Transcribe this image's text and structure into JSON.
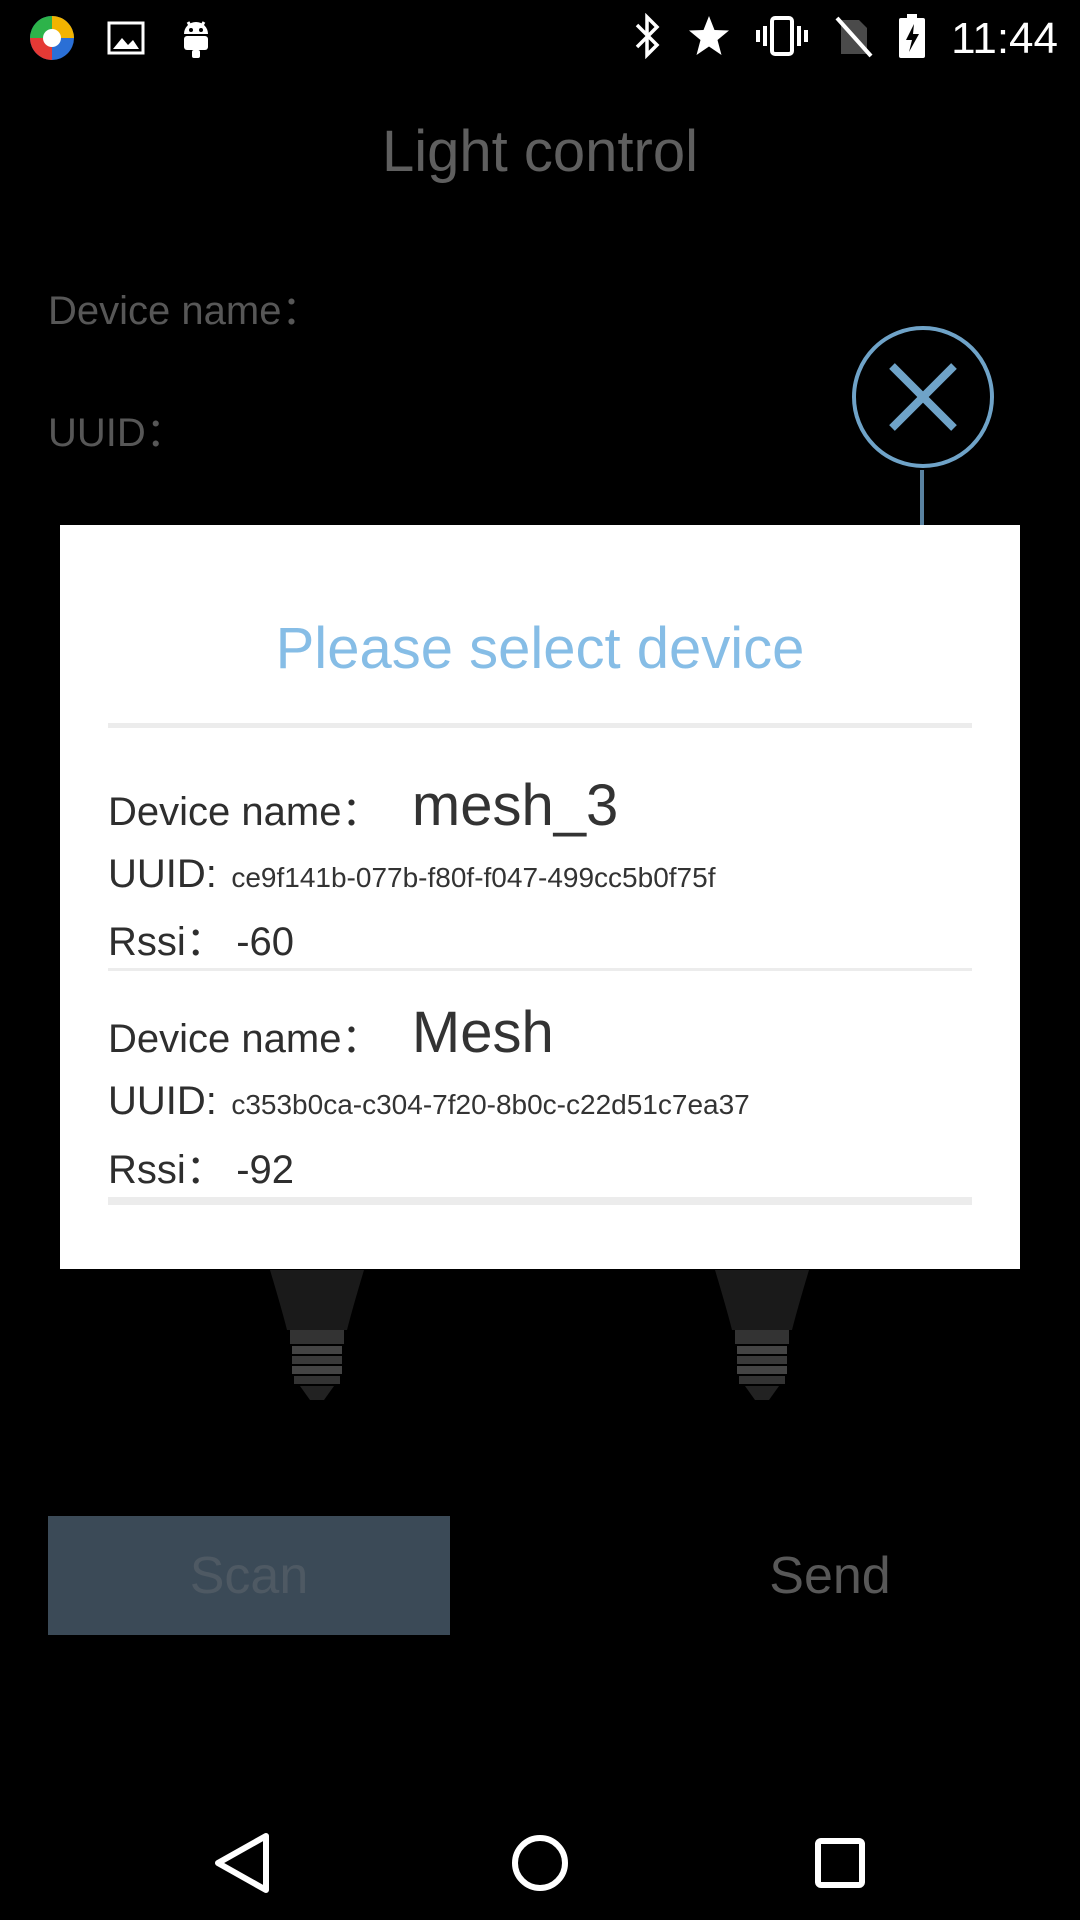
{
  "status_bar": {
    "time": "11:44",
    "left_icons": [
      "app-icon",
      "gallery-icon",
      "android-icon"
    ],
    "right_icons": [
      "bluetooth-icon",
      "star-icon",
      "vibrate-icon",
      "no-sim-icon",
      "battery-charging-icon"
    ]
  },
  "screen": {
    "title": "Light control",
    "device_name_label": "Device name：",
    "uuid_label": "UUID：",
    "scan_label": "Scan",
    "send_label": "Send"
  },
  "dialog": {
    "title": "Please select device",
    "devices": [
      {
        "name_label": "Device name：",
        "name": "mesh_3",
        "uuid_label": "UUID:",
        "uuid": "ce9f141b-077b-f80f-f047-499cc5b0f75f",
        "rssi_label": "Rssi：",
        "rssi": "-60"
      },
      {
        "name_label": "Device name：",
        "name": "Mesh",
        "uuid_label": "UUID:",
        "uuid": "c353b0ca-c304-7f20-8b0c-c22d51c7ea37",
        "rssi_label": "Rssi：",
        "rssi": "-92"
      }
    ]
  },
  "colors": {
    "accent": "#86bde6",
    "scan_button_bg": "#3b4a57",
    "background": "#000000",
    "dialog_bg": "#ffffff"
  }
}
